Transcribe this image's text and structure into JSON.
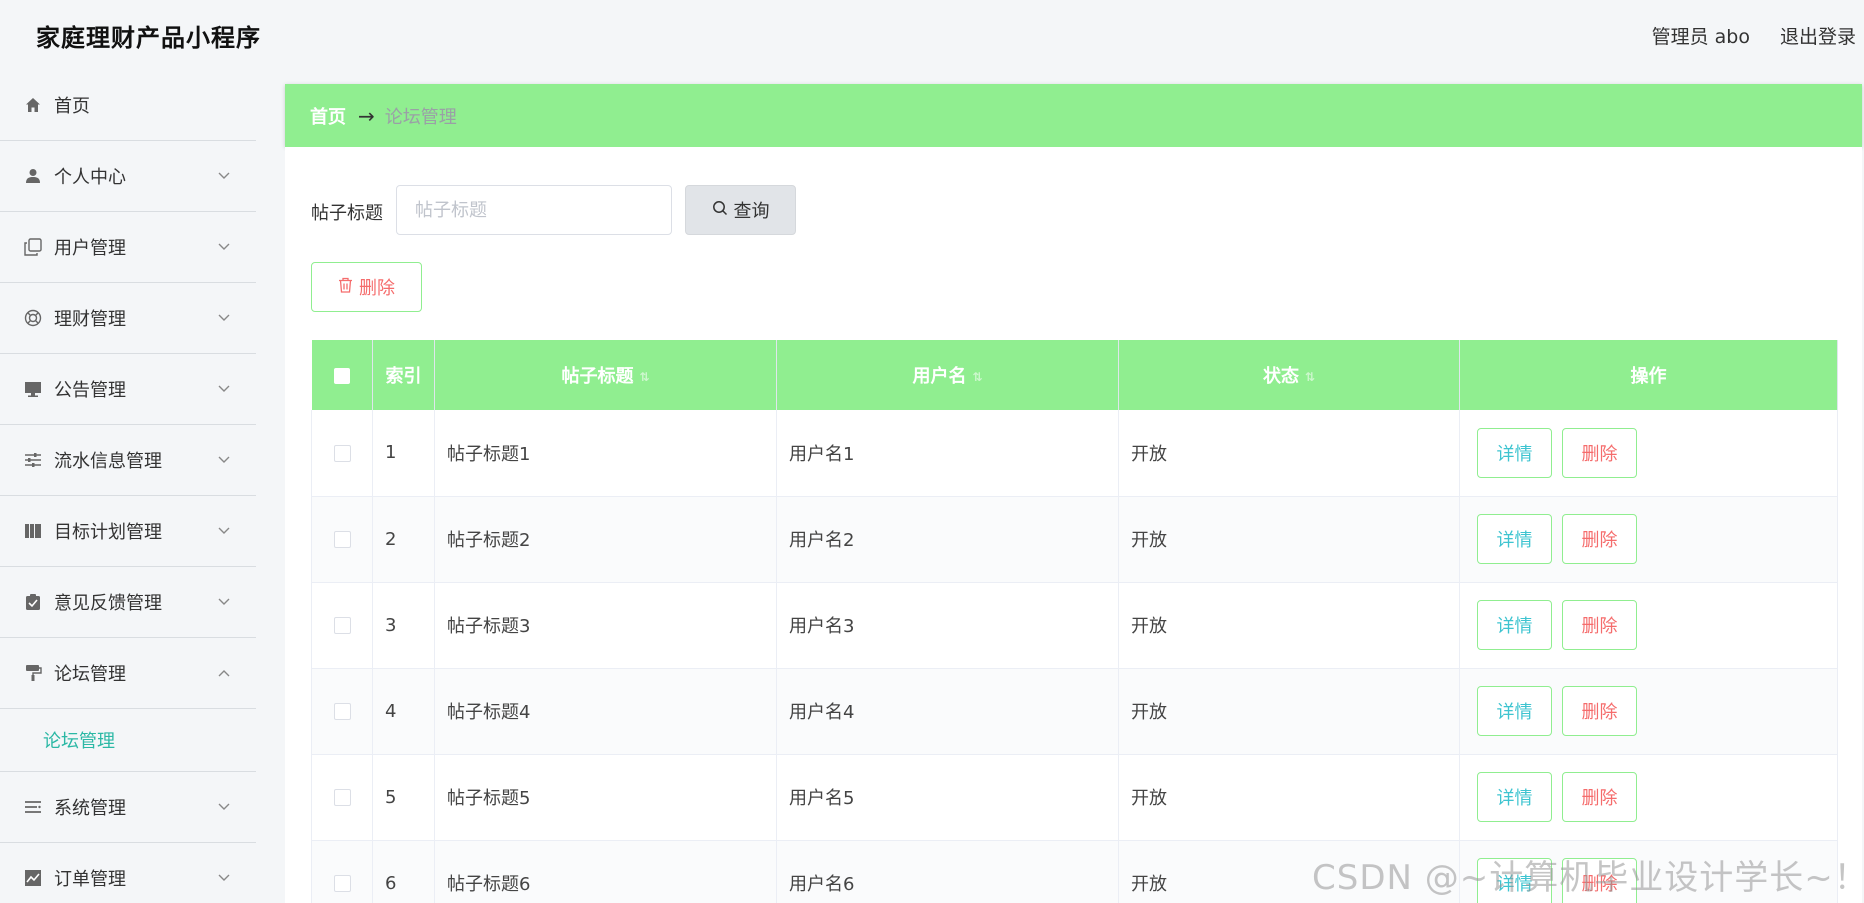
{
  "app": {
    "title": "家庭理财产品小程序"
  },
  "header": {
    "admin_label": "管理员 abo",
    "logout_label": "退出登录"
  },
  "sidebar": {
    "items": [
      {
        "label": "首页",
        "icon": "home-icon",
        "expandable": false
      },
      {
        "label": "个人中心",
        "icon": "user-icon",
        "expandable": true
      },
      {
        "label": "用户管理",
        "icon": "copy-icon",
        "expandable": true
      },
      {
        "label": "理财管理",
        "icon": "lifebuoy-icon",
        "expandable": true
      },
      {
        "label": "公告管理",
        "icon": "monitor-icon",
        "expandable": true
      },
      {
        "label": "流水信息管理",
        "icon": "sliders-icon",
        "expandable": true
      },
      {
        "label": "目标计划管理",
        "icon": "books-icon",
        "expandable": true
      },
      {
        "label": "意见反馈管理",
        "icon": "clipboard-check-icon",
        "expandable": true
      },
      {
        "label": "论坛管理",
        "icon": "paint-roller-icon",
        "expandable": true,
        "expanded": true
      },
      {
        "label": "系统管理",
        "icon": "list-icon",
        "expandable": true
      },
      {
        "label": "订单管理",
        "icon": "chart-icon",
        "expandable": true
      }
    ],
    "submenu_active": "论坛管理"
  },
  "breadcrumb": {
    "home": "首页",
    "arrow": "→",
    "current": "论坛管理"
  },
  "search": {
    "label": "帖子标题",
    "placeholder": "帖子标题",
    "value": "",
    "button_label": "查询"
  },
  "toolbar": {
    "delete_label": "删除"
  },
  "table": {
    "headers": {
      "index": "索引",
      "title": "帖子标题",
      "username": "用户名",
      "status": "状态",
      "actions": "操作"
    },
    "rows": [
      {
        "index": "1",
        "title": "帖子标题1",
        "username": "用户名1",
        "status": "开放"
      },
      {
        "index": "2",
        "title": "帖子标题2",
        "username": "用户名2",
        "status": "开放"
      },
      {
        "index": "3",
        "title": "帖子标题3",
        "username": "用户名3",
        "status": "开放"
      },
      {
        "index": "4",
        "title": "帖子标题4",
        "username": "用户名4",
        "status": "开放"
      },
      {
        "index": "5",
        "title": "帖子标题5",
        "username": "用户名5",
        "status": "开放"
      },
      {
        "index": "6",
        "title": "帖子标题6",
        "username": "用户名6",
        "status": "开放"
      }
    ],
    "action_labels": {
      "detail": "详情",
      "delete": "删除"
    }
  },
  "watermark": "CSDN @~计算机毕业设计学长~！",
  "colors": {
    "accent_green": "#90ee90",
    "active_teal": "#2bb8a5",
    "danger": "#f56c6c",
    "detail": "#3ec4d0"
  }
}
